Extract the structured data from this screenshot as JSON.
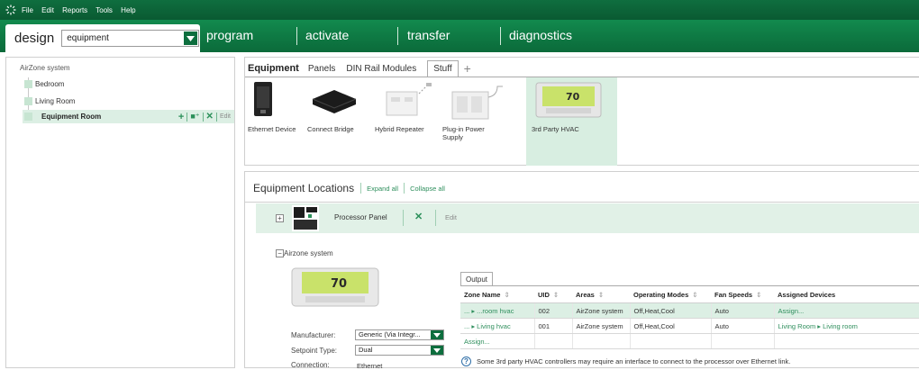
{
  "menubar": {
    "items": [
      "File",
      "Edit",
      "Reports",
      "Tools",
      "Help"
    ]
  },
  "nav": {
    "design_label": "design",
    "equipment_select": "equipment",
    "tabs": [
      "program",
      "activate",
      "transfer",
      "diagnostics"
    ]
  },
  "tree": {
    "root": "AirZone system",
    "items": [
      "Bedroom",
      "Living Room",
      "Equipment Room"
    ],
    "edit_label": "Edit"
  },
  "equipment": {
    "title": "Equipment",
    "tabs": [
      "Panels",
      "DIN Rail Modules",
      "Stuff"
    ],
    "active_tab": "Stuff",
    "devices": [
      {
        "name": "Ethernet Device"
      },
      {
        "name": "Connect Bridge"
      },
      {
        "name": "Hybrid Repeater"
      },
      {
        "name": "Plug-in Power Supply"
      },
      {
        "name": "3rd Party HVAC",
        "display": "70"
      }
    ]
  },
  "locations": {
    "title": "Equipment Locations",
    "expand_all": "Expand all",
    "collapse_all": "Collapse all",
    "processor_panel": "Processor Panel",
    "edit_label": "Edit",
    "airzone_label": "Airzone system",
    "thermostat_display": "70",
    "fields": {
      "manufacturer_label": "Manufacturer:",
      "manufacturer_value": "Generic (Via Integr...",
      "setpoint_label": "Setpoint Type:",
      "setpoint_value": "Dual",
      "connection_label": "Connection:",
      "connection_value": "Ethernet"
    },
    "output_tab": "Output",
    "table": {
      "headers": [
        "Zone Name",
        "UID",
        "Areas",
        "Operating Modes",
        "Fan Speeds",
        "Assigned Devices"
      ],
      "rows": [
        {
          "zone": "... ▸ ...room hvac",
          "uid": "002",
          "areas": "AirZone system",
          "modes": "Off,Heat,Cool",
          "fan": "Auto",
          "assigned": "Assign..."
        },
        {
          "zone": "... ▸ Living hvac",
          "uid": "001",
          "areas": "AirZone system",
          "modes": "Off,Heat,Cool",
          "fan": "Auto",
          "assigned": "Living Room ▸ Living room"
        }
      ],
      "assign_label": "Assign..."
    },
    "note": "Some 3rd party HVAC controllers may require an interface to connect to the processor over Ethernet link."
  },
  "colors": {
    "brand_green": "#0d6e3e",
    "highlight": "#dcefe4",
    "link": "#2f8f5d"
  }
}
